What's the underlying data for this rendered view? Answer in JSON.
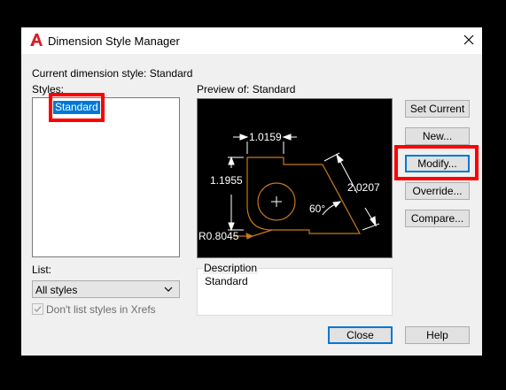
{
  "dialog": {
    "title": "Dimension Style Manager",
    "current_style_label": "Current dimension style: Standard",
    "styles_label": "Styles:",
    "preview_label": "Preview of: Standard"
  },
  "styles_list": {
    "items": [
      "Standard"
    ],
    "selected": "Standard"
  },
  "list_filter": {
    "label": "List:",
    "value": "All styles"
  },
  "xrefs_checkbox": {
    "label": "Don't list styles in Xrefs",
    "checked": true,
    "enabled": false
  },
  "preview": {
    "dim_top": "1.0159",
    "dim_left": "1.1955",
    "dim_right": "2.0207",
    "angle": "60°",
    "radius": "R0.8045"
  },
  "description": {
    "legend": "Description",
    "text": "Standard"
  },
  "buttons": {
    "set_current": "Set Current",
    "new": "New...",
    "modify": "Modify...",
    "override": "Override...",
    "compare": "Compare...",
    "close": "Close",
    "help": "Help"
  },
  "colors": {
    "highlight_red": "#ff0000",
    "selection_blue": "#0078d7",
    "preview_geometry": "#c8781e",
    "acad_red": "#d81f26"
  }
}
